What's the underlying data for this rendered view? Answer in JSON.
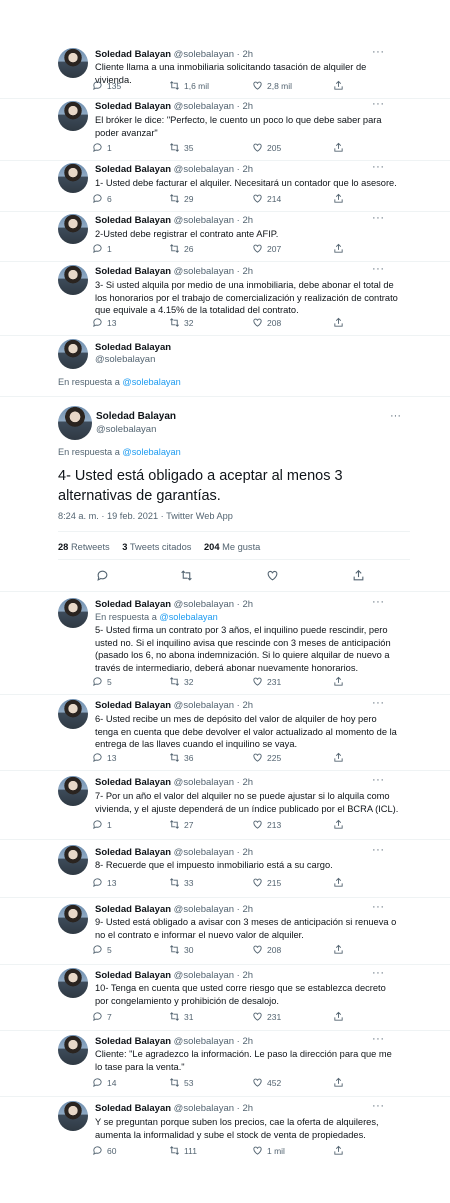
{
  "author": {
    "name": "Soledad Balayan",
    "handle": "@solebalayan",
    "time": "2h"
  },
  "more_label": "···",
  "reply_prefix": "En respuesta a",
  "reply_link": "@solebalayan",
  "tweets_top": [
    {
      "text": "Cliente llama a una inmobiliaria solicitando tasación de alquiler de vivienda.",
      "replies": "135",
      "retweets": "1,6 mil",
      "likes": "2,8 mil"
    },
    {
      "text": "El bróker le dice: \"Perfecto, le cuento un poco lo que debe saber para poder avanzar\"",
      "replies": "1",
      "retweets": "35",
      "likes": "205"
    },
    {
      "text": "1- Usted debe facturar el alquiler. Necesitará un contador que lo asesore.",
      "replies": "6",
      "retweets": "29",
      "likes": "214"
    },
    {
      "text": "2-Usted debe registrar el contrato ante AFIP.",
      "replies": "1",
      "retweets": "26",
      "likes": "207"
    },
    {
      "text": "3- Si usted alquila por medio de una inmobiliaria, debe abonar el total de los honorarios por el trabajo de comercialización y realización de contrato que equivale a 4.15% de la totalidad del contrato.",
      "replies": "13",
      "retweets": "32",
      "likes": "208"
    }
  ],
  "focused": {
    "text": "4- Usted está obligado a aceptar al menos 3 alternativas de garantías.",
    "meta": "8:24 a. m. · 19 feb. 2021 · Twitter Web App",
    "retweets_count": "28",
    "retweets_label": "Retweets",
    "quotes_count": "3",
    "quotes_label": "Tweets citados",
    "likes_count": "204",
    "likes_label": "Me gusta"
  },
  "tweets_bottom": [
    {
      "text": "5- Usted firma un contrato por 3 años, el inquilino puede rescindir, pero usted no. Si el inquilino avisa que rescinde con 3 meses de anticipación (pasado los 6, no abona indemnización. Si lo quiere alquilar de nuevo a través de intermediario, deberá abonar nuevamente honorarios.",
      "replies": "5",
      "retweets": "32",
      "likes": "231"
    },
    {
      "text": "6- Usted recibe un mes de depósito del valor de alquiler de hoy pero tenga en cuenta que debe devolver el valor actualizado al momento de la entrega de las llaves cuando el inquilino se vaya.",
      "replies": "13",
      "retweets": "36",
      "likes": "225"
    },
    {
      "text": "7- Por un año el valor del alquiler no se puede ajustar si lo alquila como vivienda, y el ajuste dependerá de un índice publicado por el BCRA (ICL).",
      "replies": "1",
      "retweets": "27",
      "likes": "213"
    },
    {
      "text": "8- Recuerde que el impuesto inmobiliario está a su cargo.",
      "replies": "13",
      "retweets": "33",
      "likes": "215"
    },
    {
      "text": "9- Usted está obligado a avisar con 3 meses de anticipación si renueva o no el contrato e informar el nuevo valor de alquiler.",
      "replies": "5",
      "retweets": "30",
      "likes": "208"
    },
    {
      "text": "10- Tenga en cuenta que usted corre riesgo que se establezca decreto por congelamiento y prohibición de desalojo.",
      "replies": "7",
      "retweets": "31",
      "likes": "231"
    },
    {
      "text": "Cliente: \"Le agradezco la información. Le paso la dirección para que me lo tase para la venta.\"",
      "replies": "14",
      "retweets": "53",
      "likes": "452"
    },
    {
      "text": "Y se preguntan porque suben los precios, cae la oferta de alquileres, aumenta la informalidad y sube el stock de venta de propiedades.",
      "replies": "60",
      "retweets": "111",
      "likes": "1 mil"
    }
  ]
}
